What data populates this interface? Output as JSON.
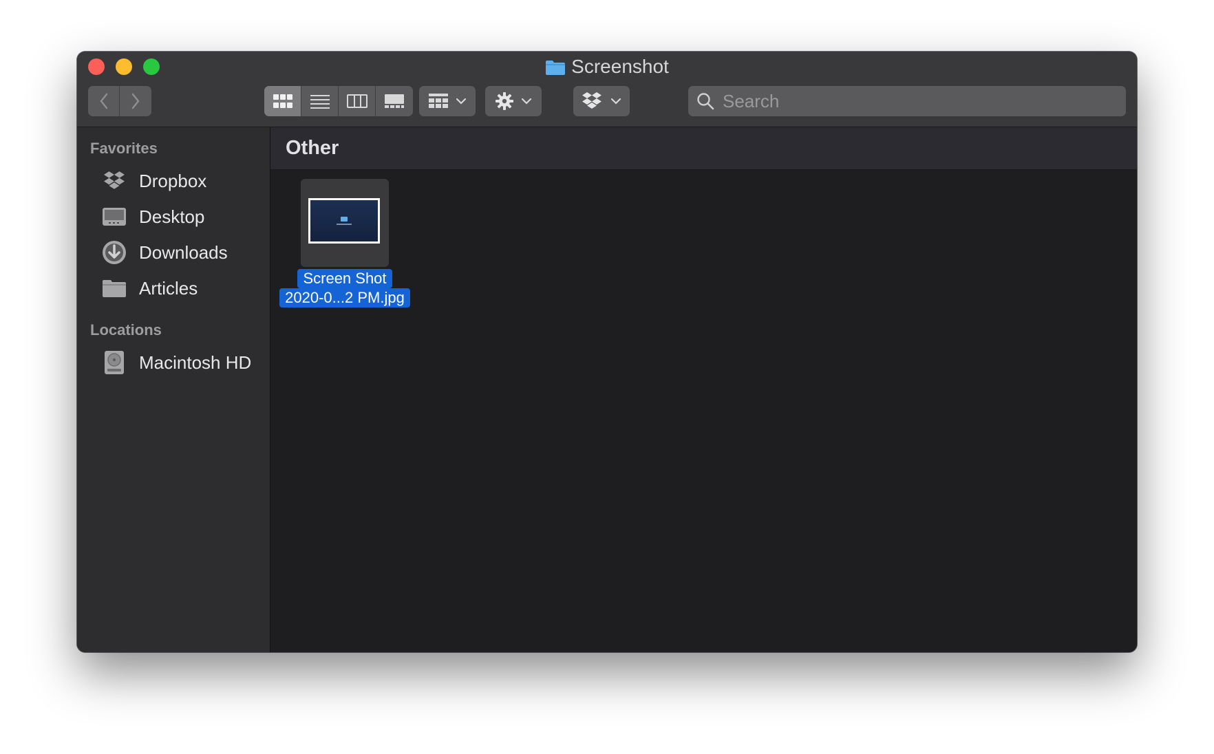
{
  "window": {
    "title": "Screenshot"
  },
  "toolbar": {
    "back_icon": "chevron-left-icon",
    "forward_icon": "chevron-right-icon",
    "view_modes": [
      "icon-view",
      "list-view",
      "column-view",
      "gallery-view"
    ],
    "active_view": "icon-view",
    "search_placeholder": "Search"
  },
  "sidebar": {
    "favorites_heading": "Favorites",
    "favorites": [
      {
        "label": "Dropbox",
        "icon": "dropbox-icon"
      },
      {
        "label": "Desktop",
        "icon": "desktop-icon"
      },
      {
        "label": "Downloads",
        "icon": "downloads-icon"
      },
      {
        "label": "Articles",
        "icon": "folder-icon"
      }
    ],
    "locations_heading": "Locations",
    "locations": [
      {
        "label": "Macintosh HD",
        "icon": "hard-drive-icon"
      }
    ]
  },
  "main": {
    "group_title": "Other",
    "files": [
      {
        "name_line1": "Screen Shot",
        "name_line2": "2020-0...2 PM.jpg",
        "selected": true
      }
    ]
  },
  "colors": {
    "close": "#fe5f57",
    "minimize": "#febc2e",
    "maximize": "#28c840",
    "selection": "#1464d6",
    "folder": "#5eb0ec"
  }
}
